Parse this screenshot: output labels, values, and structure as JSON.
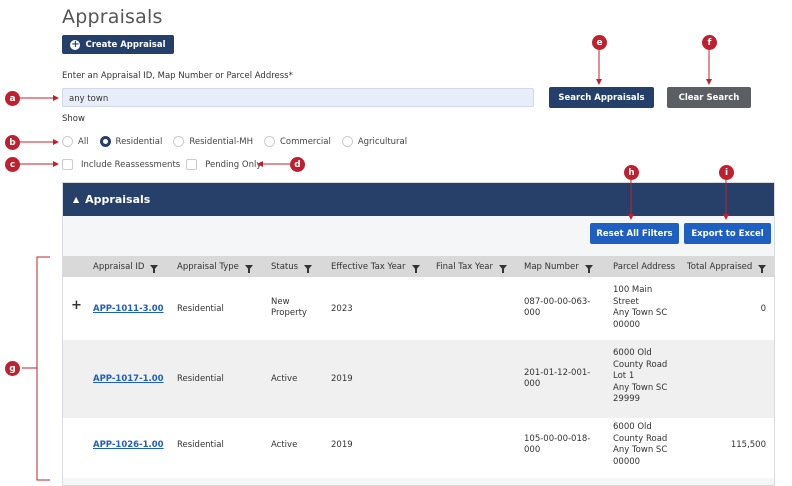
{
  "page": {
    "title": "Appraisals",
    "create_button": "Create Appraisal"
  },
  "search": {
    "label": "Enter an Appraisal ID, Map Number or Parcel Address",
    "required_mark": "*",
    "value": "any town",
    "search_button": "Search Appraisals",
    "clear_button": "Clear Search"
  },
  "show": {
    "label": "Show",
    "options": [
      "All",
      "Residential",
      "Residential-MH",
      "Commercial",
      "Agricultural"
    ],
    "selected": "Residential",
    "include_reassessments": "Include Reassessments",
    "pending_only": "Pending Only"
  },
  "panel": {
    "title": "Appraisals",
    "reset_button": "Reset All Filters",
    "export_button": "Export to Excel",
    "columns": [
      "Appraisal ID",
      "Appraisal Type",
      "Status",
      "Effective Tax Year",
      "Final Tax Year",
      "Map Number",
      "Parcel Address",
      "Total Appraised"
    ],
    "rows": [
      {
        "expand": "+",
        "id": "APP-1011-3.00",
        "type": "Residential",
        "status_1": "New",
        "status_2": "Property",
        "eff_year": "2023",
        "final_year": "",
        "map_1": "087-00-00-063-",
        "map_2": "000",
        "addr": [
          "100 Main",
          "Street",
          "Any Town SC",
          "00000"
        ],
        "total": "0"
      },
      {
        "expand": "",
        "id": "APP-1017-1.00",
        "type": "Residential",
        "status_1": "Active",
        "status_2": "",
        "eff_year": "2019",
        "final_year": "",
        "map_1": "201-01-12-001-",
        "map_2": "000",
        "addr": [
          "6000 Old",
          "County Road",
          "Lot 1",
          "Any Town SC",
          "29999"
        ],
        "total": ""
      },
      {
        "expand": "",
        "id": "APP-1026-1.00",
        "type": "Residential",
        "status_1": "Active",
        "status_2": "",
        "eff_year": "2019",
        "final_year": "",
        "map_1": "105-00-00-018-",
        "map_2": "000",
        "addr": [
          "6000 Old",
          "County Road",
          "Any Town SC",
          "00000"
        ],
        "total": "115,500"
      }
    ]
  },
  "callouts": {
    "a": "a",
    "b": "b",
    "c": "c",
    "d": "d",
    "e": "e",
    "f": "f",
    "g": "g",
    "h": "h",
    "i": "i"
  },
  "colors": {
    "primary": "#24406a",
    "action_blue": "#1f5fbf",
    "callout_red": "#c0202e"
  }
}
